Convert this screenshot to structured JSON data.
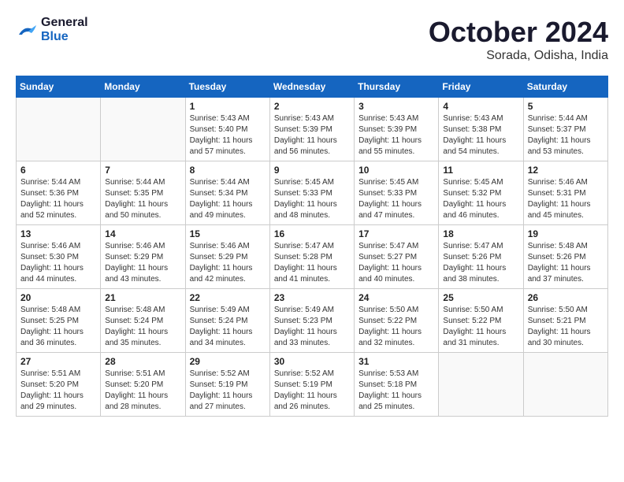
{
  "header": {
    "logo_line1": "General",
    "logo_line2": "Blue",
    "month_title": "October 2024",
    "location": "Sorada, Odisha, India"
  },
  "weekdays": [
    "Sunday",
    "Monday",
    "Tuesday",
    "Wednesday",
    "Thursday",
    "Friday",
    "Saturday"
  ],
  "weeks": [
    [
      {
        "day": null,
        "sunrise": null,
        "sunset": null,
        "daylight": null
      },
      {
        "day": null,
        "sunrise": null,
        "sunset": null,
        "daylight": null
      },
      {
        "day": "1",
        "sunrise": "Sunrise: 5:43 AM",
        "sunset": "Sunset: 5:40 PM",
        "daylight": "Daylight: 11 hours and 57 minutes."
      },
      {
        "day": "2",
        "sunrise": "Sunrise: 5:43 AM",
        "sunset": "Sunset: 5:39 PM",
        "daylight": "Daylight: 11 hours and 56 minutes."
      },
      {
        "day": "3",
        "sunrise": "Sunrise: 5:43 AM",
        "sunset": "Sunset: 5:39 PM",
        "daylight": "Daylight: 11 hours and 55 minutes."
      },
      {
        "day": "4",
        "sunrise": "Sunrise: 5:43 AM",
        "sunset": "Sunset: 5:38 PM",
        "daylight": "Daylight: 11 hours and 54 minutes."
      },
      {
        "day": "5",
        "sunrise": "Sunrise: 5:44 AM",
        "sunset": "Sunset: 5:37 PM",
        "daylight": "Daylight: 11 hours and 53 minutes."
      }
    ],
    [
      {
        "day": "6",
        "sunrise": "Sunrise: 5:44 AM",
        "sunset": "Sunset: 5:36 PM",
        "daylight": "Daylight: 11 hours and 52 minutes."
      },
      {
        "day": "7",
        "sunrise": "Sunrise: 5:44 AM",
        "sunset": "Sunset: 5:35 PM",
        "daylight": "Daylight: 11 hours and 50 minutes."
      },
      {
        "day": "8",
        "sunrise": "Sunrise: 5:44 AM",
        "sunset": "Sunset: 5:34 PM",
        "daylight": "Daylight: 11 hours and 49 minutes."
      },
      {
        "day": "9",
        "sunrise": "Sunrise: 5:45 AM",
        "sunset": "Sunset: 5:33 PM",
        "daylight": "Daylight: 11 hours and 48 minutes."
      },
      {
        "day": "10",
        "sunrise": "Sunrise: 5:45 AM",
        "sunset": "Sunset: 5:33 PM",
        "daylight": "Daylight: 11 hours and 47 minutes."
      },
      {
        "day": "11",
        "sunrise": "Sunrise: 5:45 AM",
        "sunset": "Sunset: 5:32 PM",
        "daylight": "Daylight: 11 hours and 46 minutes."
      },
      {
        "day": "12",
        "sunrise": "Sunrise: 5:46 AM",
        "sunset": "Sunset: 5:31 PM",
        "daylight": "Daylight: 11 hours and 45 minutes."
      }
    ],
    [
      {
        "day": "13",
        "sunrise": "Sunrise: 5:46 AM",
        "sunset": "Sunset: 5:30 PM",
        "daylight": "Daylight: 11 hours and 44 minutes."
      },
      {
        "day": "14",
        "sunrise": "Sunrise: 5:46 AM",
        "sunset": "Sunset: 5:29 PM",
        "daylight": "Daylight: 11 hours and 43 minutes."
      },
      {
        "day": "15",
        "sunrise": "Sunrise: 5:46 AM",
        "sunset": "Sunset: 5:29 PM",
        "daylight": "Daylight: 11 hours and 42 minutes."
      },
      {
        "day": "16",
        "sunrise": "Sunrise: 5:47 AM",
        "sunset": "Sunset: 5:28 PM",
        "daylight": "Daylight: 11 hours and 41 minutes."
      },
      {
        "day": "17",
        "sunrise": "Sunrise: 5:47 AM",
        "sunset": "Sunset: 5:27 PM",
        "daylight": "Daylight: 11 hours and 40 minutes."
      },
      {
        "day": "18",
        "sunrise": "Sunrise: 5:47 AM",
        "sunset": "Sunset: 5:26 PM",
        "daylight": "Daylight: 11 hours and 38 minutes."
      },
      {
        "day": "19",
        "sunrise": "Sunrise: 5:48 AM",
        "sunset": "Sunset: 5:26 PM",
        "daylight": "Daylight: 11 hours and 37 minutes."
      }
    ],
    [
      {
        "day": "20",
        "sunrise": "Sunrise: 5:48 AM",
        "sunset": "Sunset: 5:25 PM",
        "daylight": "Daylight: 11 hours and 36 minutes."
      },
      {
        "day": "21",
        "sunrise": "Sunrise: 5:48 AM",
        "sunset": "Sunset: 5:24 PM",
        "daylight": "Daylight: 11 hours and 35 minutes."
      },
      {
        "day": "22",
        "sunrise": "Sunrise: 5:49 AM",
        "sunset": "Sunset: 5:24 PM",
        "daylight": "Daylight: 11 hours and 34 minutes."
      },
      {
        "day": "23",
        "sunrise": "Sunrise: 5:49 AM",
        "sunset": "Sunset: 5:23 PM",
        "daylight": "Daylight: 11 hours and 33 minutes."
      },
      {
        "day": "24",
        "sunrise": "Sunrise: 5:50 AM",
        "sunset": "Sunset: 5:22 PM",
        "daylight": "Daylight: 11 hours and 32 minutes."
      },
      {
        "day": "25",
        "sunrise": "Sunrise: 5:50 AM",
        "sunset": "Sunset: 5:22 PM",
        "daylight": "Daylight: 11 hours and 31 minutes."
      },
      {
        "day": "26",
        "sunrise": "Sunrise: 5:50 AM",
        "sunset": "Sunset: 5:21 PM",
        "daylight": "Daylight: 11 hours and 30 minutes."
      }
    ],
    [
      {
        "day": "27",
        "sunrise": "Sunrise: 5:51 AM",
        "sunset": "Sunset: 5:20 PM",
        "daylight": "Daylight: 11 hours and 29 minutes."
      },
      {
        "day": "28",
        "sunrise": "Sunrise: 5:51 AM",
        "sunset": "Sunset: 5:20 PM",
        "daylight": "Daylight: 11 hours and 28 minutes."
      },
      {
        "day": "29",
        "sunrise": "Sunrise: 5:52 AM",
        "sunset": "Sunset: 5:19 PM",
        "daylight": "Daylight: 11 hours and 27 minutes."
      },
      {
        "day": "30",
        "sunrise": "Sunrise: 5:52 AM",
        "sunset": "Sunset: 5:19 PM",
        "daylight": "Daylight: 11 hours and 26 minutes."
      },
      {
        "day": "31",
        "sunrise": "Sunrise: 5:53 AM",
        "sunset": "Sunset: 5:18 PM",
        "daylight": "Daylight: 11 hours and 25 minutes."
      },
      {
        "day": null,
        "sunrise": null,
        "sunset": null,
        "daylight": null
      },
      {
        "day": null,
        "sunrise": null,
        "sunset": null,
        "daylight": null
      }
    ]
  ]
}
